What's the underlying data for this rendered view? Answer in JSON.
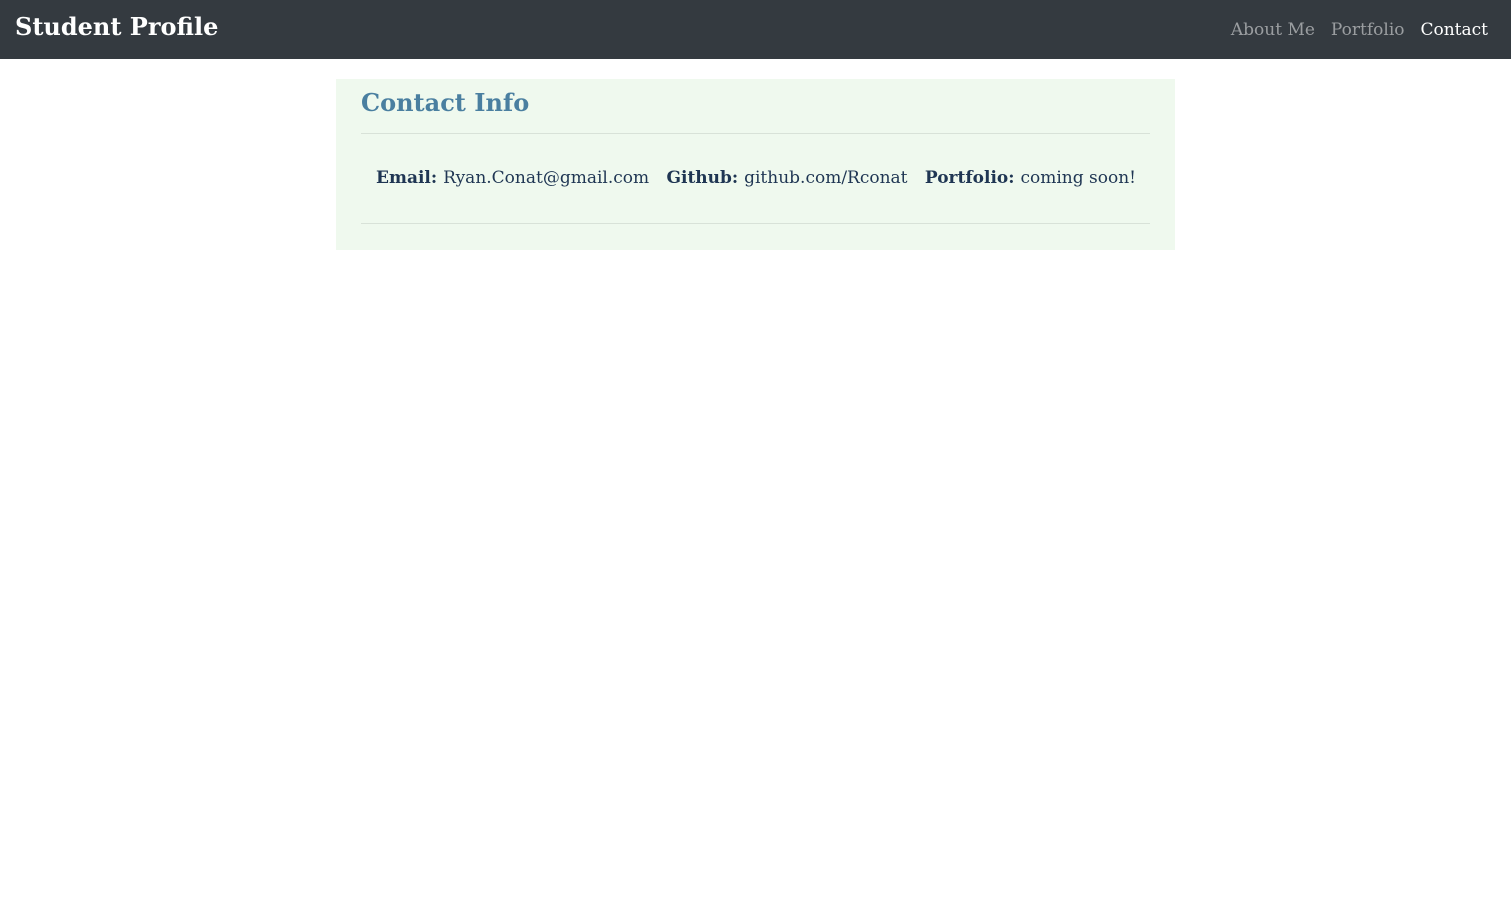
{
  "navbar": {
    "brand": "Student Profile",
    "links": [
      {
        "label": "About Me"
      },
      {
        "label": "Portfolio"
      },
      {
        "label": "Contact"
      }
    ]
  },
  "card": {
    "title": "Contact Info",
    "items": [
      {
        "key": "Email:",
        "value": "Ryan.Conat@gmail.com"
      },
      {
        "key": "Github:",
        "value": "github.com/Rconat"
      },
      {
        "key": "Portfolio:",
        "value": "coming soon!"
      }
    ]
  },
  "colors": {
    "navbar_bg": "#343a40",
    "card_bg": "#eff9ee",
    "title": "#4a7fa0",
    "text": "#1f3653"
  }
}
